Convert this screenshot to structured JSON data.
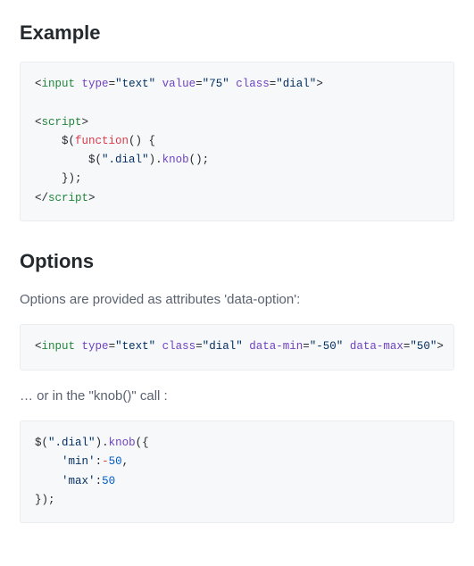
{
  "sections": {
    "example": {
      "heading": "Example"
    },
    "options": {
      "heading": "Options",
      "intro": "Options are provided as attributes 'data-option':",
      "alt": "… or in the \"knob()\" call :"
    }
  },
  "code": {
    "ex1": {
      "l1_open": "<",
      "l1_tag": "input",
      "l1_sp": " ",
      "l1_attr1": "type",
      "l1_eq": "=",
      "l1_q": "\"",
      "l1_val1": "text",
      "l1_attr2": "value",
      "l1_val2": "75",
      "l1_attr3": "class",
      "l1_val3": "dial",
      "l1_close": ">",
      "l3_tag": "script",
      "l4_indent": "    ",
      "l4_dollar": "$(",
      "l4_fn": "function",
      "l4_paren": "() {",
      "l5_indent": "        ",
      "l5_call": "$(",
      "l5_sel": ".dial",
      "l5_mid": ").",
      "l5_knob": "knob",
      "l5_end": "();",
      "l6_indent": "    ",
      "l6_close": "});",
      "l7_open": "</",
      "l7_close": ">"
    },
    "ex2": {
      "attr_min": "data-min",
      "val_min": "-50",
      "attr_max": "data-max",
      "val_max": "50"
    },
    "ex3": {
      "l1_a": "$(",
      "l1_sel": ".dial",
      "l1_b": ").",
      "l1_knob": "knob",
      "l1_c": "({",
      "l2_indent": "    ",
      "l2_key": "min",
      "l2_colon": ":",
      "l2_neg": "-",
      "l2_val": "50",
      "l2_comma": ",",
      "l3_indent": "    ",
      "l3_key": "max",
      "l3_colon": ":",
      "l3_val": "50",
      "l4": "});"
    }
  }
}
